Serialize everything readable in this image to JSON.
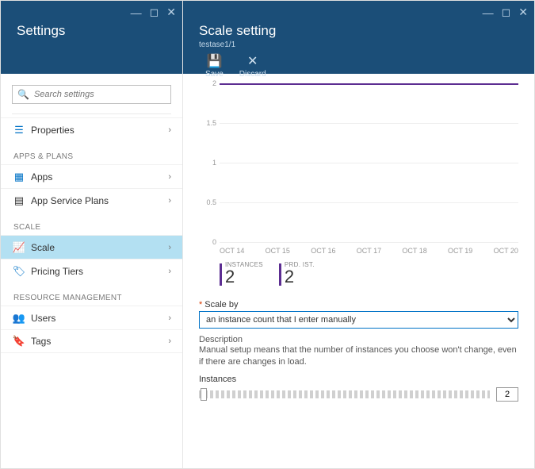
{
  "left": {
    "title": "Settings",
    "search_placeholder": "Search settings",
    "sections": {
      "top": {
        "item_properties": "Properties"
      },
      "apps_plans": {
        "header": "APPS & PLANS",
        "item_apps": "Apps",
        "item_app_service_plans": "App Service Plans"
      },
      "scale": {
        "header": "SCALE",
        "item_scale": "Scale",
        "item_pricing_tiers": "Pricing Tiers"
      },
      "resource_mgmt": {
        "header": "RESOURCE MANAGEMENT",
        "item_users": "Users",
        "item_tags": "Tags"
      }
    }
  },
  "right": {
    "title": "Scale setting",
    "subtitle": "testase1/1",
    "toolbar": {
      "save": "Save",
      "discard": "Discard"
    },
    "chart_data": {
      "type": "line",
      "x_ticks": [
        "OCT 14",
        "OCT 15",
        "OCT 16",
        "OCT 17",
        "OCT 18",
        "OCT 19",
        "OCT 20"
      ],
      "y_ticks": [
        "0",
        "0.5",
        "1",
        "1.5",
        "2"
      ],
      "ylim": [
        0,
        2
      ],
      "series": [
        {
          "name": "Instances",
          "color": "#5c2d91",
          "value_constant": 2
        }
      ],
      "metrics": {
        "instances": {
          "label": "INSTANCES",
          "value": "2"
        },
        "prd_ist": {
          "label": "PRD. IST.",
          "value": "2"
        }
      }
    },
    "form": {
      "scale_by_label": "Scale by",
      "scale_by_value": "an instance count that I enter manually",
      "description_label": "Description",
      "description_text": "Manual setup means that the number of instances you choose won't change, even if there are changes in load.",
      "instances_label": "Instances",
      "instances_value": "2"
    }
  }
}
